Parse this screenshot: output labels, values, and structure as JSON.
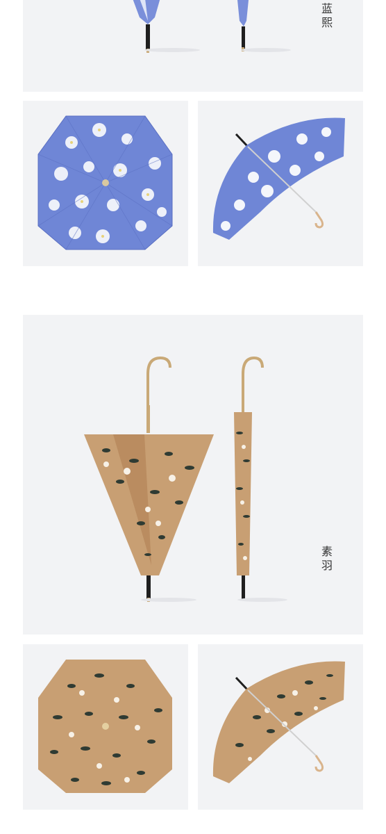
{
  "sections": [
    {
      "name_label": "蓝熙",
      "theme": "blue-floral",
      "colors": {
        "canopy": "#6f86d6",
        "canopy_light": "#9aaee8",
        "flower": "#f4f6fb",
        "center": "#e7d27a"
      }
    },
    {
      "name_label": "素羽",
      "theme": "tan-leaf",
      "colors": {
        "canopy": "#c89f73",
        "canopy_dark": "#b48558",
        "leaf": "#2f3b33",
        "flower": "#f7f1e7",
        "handle": "#c9a977"
      }
    }
  ]
}
